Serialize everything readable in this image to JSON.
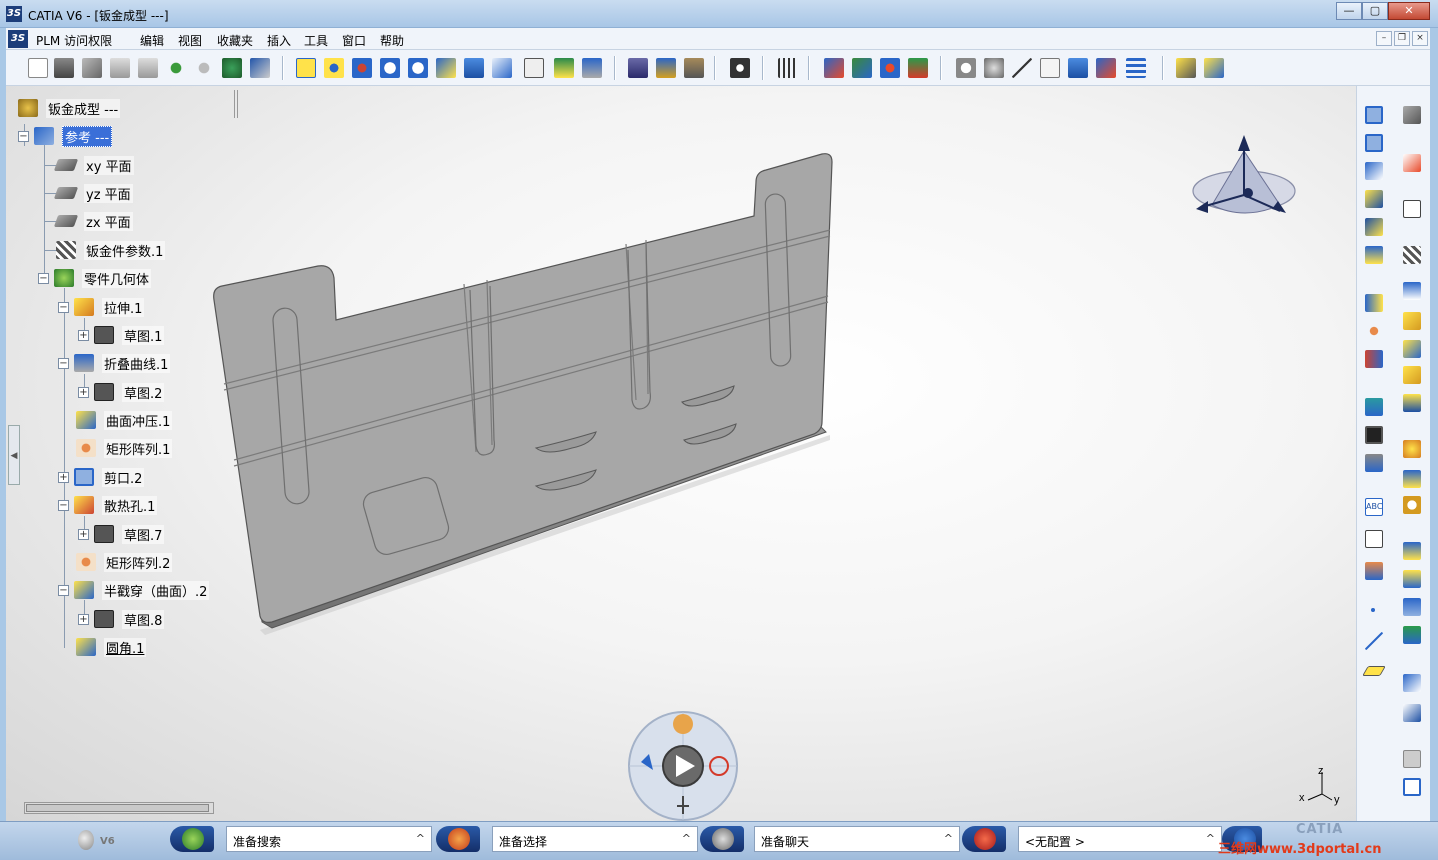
{
  "window": {
    "title": "CATIA V6 - [钣金成型 ---]",
    "controls": [
      "—",
      "▢",
      "✕"
    ]
  },
  "menubar": {
    "items": [
      "PLM 访问权限",
      "编辑",
      "视图",
      "收藏夹",
      "插入",
      "工具",
      "窗口",
      "帮助"
    ]
  },
  "tree": {
    "root": "钣金成型 ---",
    "reference": "参考 ---",
    "planes": [
      "xy 平面",
      "yz 平面",
      "zx 平面"
    ],
    "sheet_params": "钣金件参数.1",
    "part_body": "零件几何体",
    "features": {
      "extrude": "拉伸.1",
      "sketch1": "草图.1",
      "fold": "折叠曲线.1",
      "sketch2": "草图.2",
      "surface_stamp": "曲面冲压.1",
      "pattern1": "矩形阵列.1",
      "cutout": "剪口.2",
      "louver": "散热孔.1",
      "sketch7": "草图.7",
      "pattern2": "矩形阵列.2",
      "bridge": "半戳穿（曲面）.2",
      "sketch8": "草图.8",
      "fillet": "圆角.1"
    }
  },
  "axis": {
    "x": "x",
    "y": "y",
    "z": "z"
  },
  "statusbar": {
    "brand": "V6",
    "search": "准备搜索",
    "select": "准备选择",
    "chat": "准备聊天",
    "config": "<无配置 >",
    "caret": "^",
    "watermark": "三维网www.3dportal.cn",
    "logo_text": "CATIA"
  },
  "colors": {
    "titlebar": "#a8c6e6",
    "selection": "#3a6fd8",
    "part_fill": "#a7a7a7",
    "statusbar": "#9fbbdb"
  }
}
